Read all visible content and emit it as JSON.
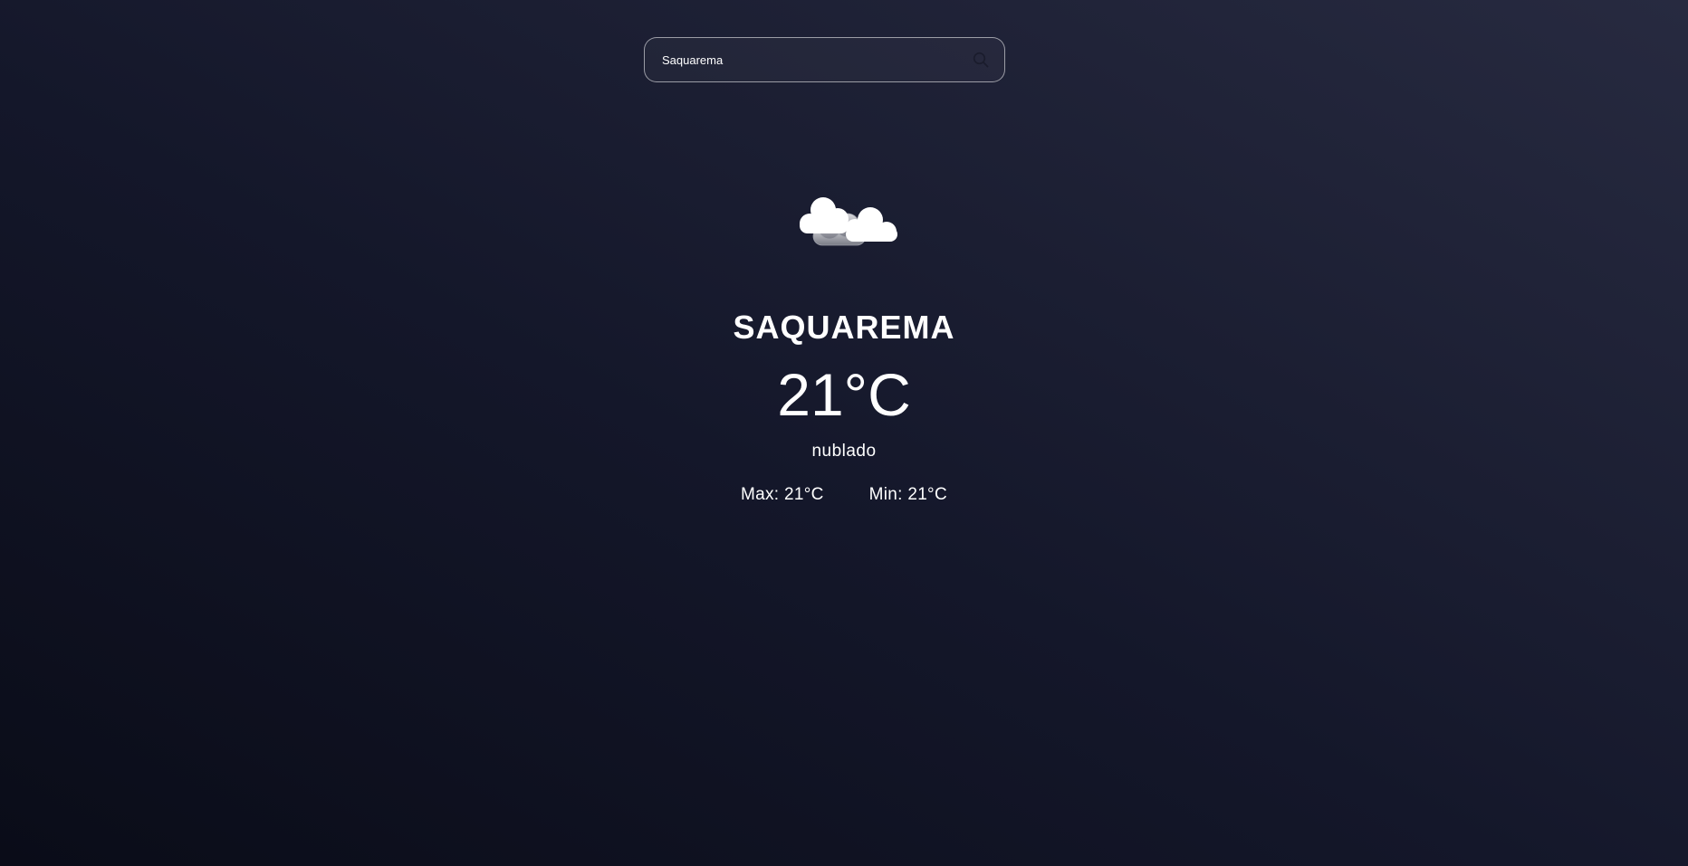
{
  "search": {
    "value": "Saquarema",
    "icon": "search-icon"
  },
  "weather": {
    "icon": "clouds-icon",
    "city": "SAQUAREMA",
    "temperature": "21°C",
    "description": "nublado",
    "max_label": "Max:",
    "max_value": "21°C",
    "min_label": "Min:",
    "min_value": "21°C"
  },
  "colors": {
    "background_top": "#272a40",
    "background_bottom": "#0a0c18",
    "text": "#ffffff"
  }
}
